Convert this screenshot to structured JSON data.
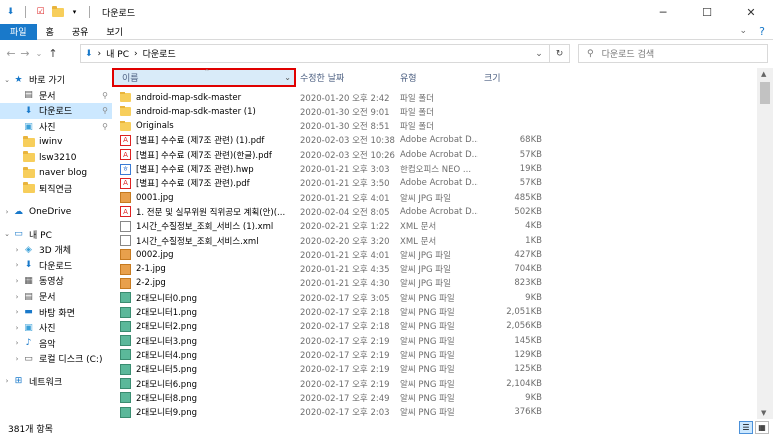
{
  "window": {
    "title": "다운로드",
    "minimize": "─",
    "maximize": "☐",
    "close": "✕"
  },
  "ribbon": {
    "tabs": [
      "파일",
      "홈",
      "공유",
      "보기"
    ],
    "help": "?",
    "collapse": "⌄"
  },
  "address": {
    "back": "←",
    "forward": "→",
    "recent": "⌄",
    "up": "↑",
    "crumbs": [
      "내 PC",
      "다운로드"
    ],
    "sep": "›",
    "dropdown": "⌄",
    "refresh": "↻",
    "search_placeholder": "다운로드 검색"
  },
  "nav": {
    "items": [
      {
        "label": "바로 가기",
        "icon": "star-icon",
        "glyph": "★",
        "expand": "⌄",
        "pinned": false,
        "level": 0
      },
      {
        "label": "문서",
        "icon": "document-icon",
        "glyph": "▤",
        "pinned": true,
        "level": 1
      },
      {
        "label": "다운로드",
        "icon": "download-icon",
        "glyph": "⬇",
        "pinned": true,
        "selected": true,
        "level": 1
      },
      {
        "label": "사진",
        "icon": "picture-icon",
        "glyph": "▣",
        "pinned": true,
        "level": 1
      },
      {
        "label": "iwinv",
        "icon": "folder-icon",
        "level": 1
      },
      {
        "label": "lsw3210",
        "icon": "folder-icon",
        "level": 1
      },
      {
        "label": "naver blog",
        "icon": "folder-icon",
        "level": 1
      },
      {
        "label": "퇴직연금",
        "icon": "folder-icon",
        "level": 1
      },
      {
        "gap": true
      },
      {
        "label": "OneDrive",
        "icon": "cloud-icon",
        "glyph": "☁",
        "expand": "›",
        "level": 0
      },
      {
        "gap": true
      },
      {
        "label": "내 PC",
        "icon": "computer-icon",
        "glyph": "▭",
        "expand": "⌄",
        "level": 0
      },
      {
        "label": "3D 개체",
        "icon": "cube-icon",
        "glyph": "◈",
        "expand": "›",
        "level": 1
      },
      {
        "label": "다운로드",
        "icon": "download-icon",
        "glyph": "⬇",
        "expand": "›",
        "level": 1
      },
      {
        "label": "동영상",
        "icon": "video-icon",
        "glyph": "▦",
        "expand": "›",
        "level": 1
      },
      {
        "label": "문서",
        "icon": "document-icon",
        "glyph": "▤",
        "expand": "›",
        "level": 1
      },
      {
        "label": "바탕 화면",
        "icon": "desktop-icon",
        "glyph": "▬",
        "expand": "›",
        "level": 1
      },
      {
        "label": "사진",
        "icon": "picture-icon",
        "glyph": "▣",
        "expand": "›",
        "level": 1
      },
      {
        "label": "음악",
        "icon": "music-icon",
        "glyph": "♪",
        "expand": "›",
        "level": 1
      },
      {
        "label": "로컬 디스크 (C:)",
        "icon": "disk-icon",
        "glyph": "▭",
        "expand": "›",
        "level": 1
      },
      {
        "gap": true
      },
      {
        "label": "네트워크",
        "icon": "network-icon",
        "glyph": "⊞",
        "expand": "›",
        "level": 0
      }
    ],
    "pin_glyph": "📌"
  },
  "columns": {
    "name": "이름",
    "date": "수정한 날짜",
    "type": "유형",
    "size": "크기",
    "sort_glyph": "⌃",
    "dd_glyph": "⌄"
  },
  "files": [
    {
      "name": "android-map-sdk-master",
      "date": "2020-01-20 오후 2:42",
      "type": "파일 폴더",
      "size": "",
      "kind": "folder"
    },
    {
      "name": "android-map-sdk-master (1)",
      "date": "2020-01-30 오전 9:01",
      "type": "파일 폴더",
      "size": "",
      "kind": "folder"
    },
    {
      "name": "Originals",
      "date": "2020-01-30 오전 8:51",
      "type": "파일 폴더",
      "size": "",
      "kind": "folder"
    },
    {
      "name": "[별표] 수수료 (제7조 관련) (1).pdf",
      "date": "2020-02-03 오전 10:38",
      "type": "Adobe Acrobat D...",
      "size": "68KB",
      "kind": "pdf"
    },
    {
      "name": "[별표] 수수료 (제7조 관련)(한글).pdf",
      "date": "2020-02-03 오전 10:26",
      "type": "Adobe Acrobat D...",
      "size": "57KB",
      "kind": "pdf"
    },
    {
      "name": "[별표] 수수료 (제7조 관련).hwp",
      "date": "2020-01-21 오후 3:03",
      "type": "한컴오피스 NEO ...",
      "size": "19KB",
      "kind": "hwp"
    },
    {
      "name": "[별표] 수수료 (제7조 관련).pdf",
      "date": "2020-01-21 오후 3:50",
      "type": "Adobe Acrobat D...",
      "size": "57KB",
      "kind": "pdf"
    },
    {
      "name": "0001.jpg",
      "date": "2020-01-21 오후 4:01",
      "type": "알씨 JPG 파일",
      "size": "485KB",
      "kind": "jpg"
    },
    {
      "name": "1. 전문 및 실무위원 직위공모 계획(안)(...",
      "date": "2020-02-04 오전 8:05",
      "type": "Adobe Acrobat D...",
      "size": "502KB",
      "kind": "pdf"
    },
    {
      "name": "1시간_수질정보_조회_서비스 (1).xml",
      "date": "2020-02-21 오후 1:22",
      "type": "XML 문서",
      "size": "4KB",
      "kind": "xml"
    },
    {
      "name": "1시간_수질정보_조회_서비스.xml",
      "date": "2020-02-20 오후 3:20",
      "type": "XML 문서",
      "size": "1KB",
      "kind": "xml"
    },
    {
      "name": "0002.jpg",
      "date": "2020-01-21 오후 4:01",
      "type": "알씨 JPG 파일",
      "size": "427KB",
      "kind": "jpg"
    },
    {
      "name": "2-1.jpg",
      "date": "2020-01-21 오후 4:35",
      "type": "알씨 JPG 파일",
      "size": "704KB",
      "kind": "jpg"
    },
    {
      "name": "2-2.jpg",
      "date": "2020-01-21 오후 4:30",
      "type": "알씨 JPG 파일",
      "size": "823KB",
      "kind": "jpg"
    },
    {
      "name": "2대모니터0.png",
      "date": "2020-02-17 오후 3:05",
      "type": "알씨 PNG 파일",
      "size": "9KB",
      "kind": "png"
    },
    {
      "name": "2대모니터1.png",
      "date": "2020-02-17 오후 2:18",
      "type": "알씨 PNG 파일",
      "size": "2,051KB",
      "kind": "png"
    },
    {
      "name": "2대모니터2.png",
      "date": "2020-02-17 오후 2:18",
      "type": "알씨 PNG 파일",
      "size": "2,056KB",
      "kind": "png"
    },
    {
      "name": "2대모니터3.png",
      "date": "2020-02-17 오후 2:19",
      "type": "알씨 PNG 파일",
      "size": "145KB",
      "kind": "png"
    },
    {
      "name": "2대모니터4.png",
      "date": "2020-02-17 오후 2:19",
      "type": "알씨 PNG 파일",
      "size": "129KB",
      "kind": "png"
    },
    {
      "name": "2대모니터5.png",
      "date": "2020-02-17 오후 2:19",
      "type": "알씨 PNG 파일",
      "size": "125KB",
      "kind": "png"
    },
    {
      "name": "2대모니터6.png",
      "date": "2020-02-17 오후 2:19",
      "type": "알씨 PNG 파일",
      "size": "2,104KB",
      "kind": "png"
    },
    {
      "name": "2대모니터8.png",
      "date": "2020-02-17 오후 2:49",
      "type": "알씨 PNG 파일",
      "size": "9KB",
      "kind": "png"
    },
    {
      "name": "2대모니터9.png",
      "date": "2020-02-17 오후 2:03",
      "type": "알씨 PNG 파일",
      "size": "376KB",
      "kind": "png"
    }
  ],
  "status": {
    "count": "381개 항목"
  },
  "colors": {
    "accent": "#1979ca",
    "selection": "#cce8ff",
    "highlight_border": "#e00000"
  }
}
